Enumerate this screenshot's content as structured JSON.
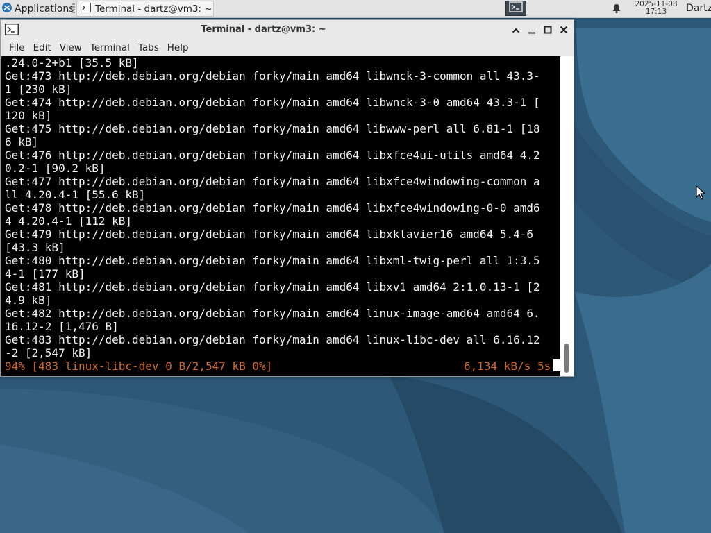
{
  "panel": {
    "applications_label": "Applications",
    "task_label": "Terminal - dartz@vm3: ~",
    "clock_date": "2025-11-08",
    "clock_time": "17:13",
    "user": "Dartz"
  },
  "window": {
    "title": "Terminal - dartz@vm3: ~",
    "menu": [
      "File",
      "Edit",
      "View",
      "Terminal",
      "Tabs",
      "Help"
    ]
  },
  "terminal": {
    "lines": [
      ".24.0-2+b1 [35.5 kB]",
      "Get:473 http://deb.debian.org/debian forky/main amd64 libwnck-3-common all 43.3-",
      "1 [230 kB]",
      "Get:474 http://deb.debian.org/debian forky/main amd64 libwnck-3-0 amd64 43.3-1 [",
      "120 kB]",
      "Get:475 http://deb.debian.org/debian forky/main amd64 libwww-perl all 6.81-1 [18",
      "6 kB]",
      "Get:476 http://deb.debian.org/debian forky/main amd64 libxfce4ui-utils amd64 4.2",
      "0.2-1 [90.2 kB]",
      "Get:477 http://deb.debian.org/debian forky/main amd64 libxfce4windowing-common a",
      "ll 4.20.4-1 [55.6 kB]",
      "Get:478 http://deb.debian.org/debian forky/main amd64 libxfce4windowing-0-0 amd6",
      "4 4.20.4-1 [112 kB]",
      "Get:479 http://deb.debian.org/debian forky/main amd64 libxklavier16 amd64 5.4-6",
      "[43.3 kB]",
      "Get:480 http://deb.debian.org/debian forky/main amd64 libxml-twig-perl all 1:3.5",
      "4-1 [177 kB]",
      "Get:481 http://deb.debian.org/debian forky/main amd64 libxv1 amd64 2:1.0.13-1 [2",
      "4.9 kB]",
      "Get:482 http://deb.debian.org/debian forky/main amd64 linux-image-amd64 amd64 6.",
      "16.12-2 [1,476 B]",
      "Get:483 http://deb.debian.org/debian forky/main amd64 linux-libc-dev all 6.16.12",
      "-2 [2,547 kB]"
    ],
    "status_left": "94% [483 linux-libc-dev 0 B/2,547 kB 0%]",
    "status_right": "6,134 kB/s 5s"
  },
  "colors": {
    "status_orange": "#d2692a",
    "terminal_bg": "#000000",
    "wallpaper": "#2f5a78"
  }
}
